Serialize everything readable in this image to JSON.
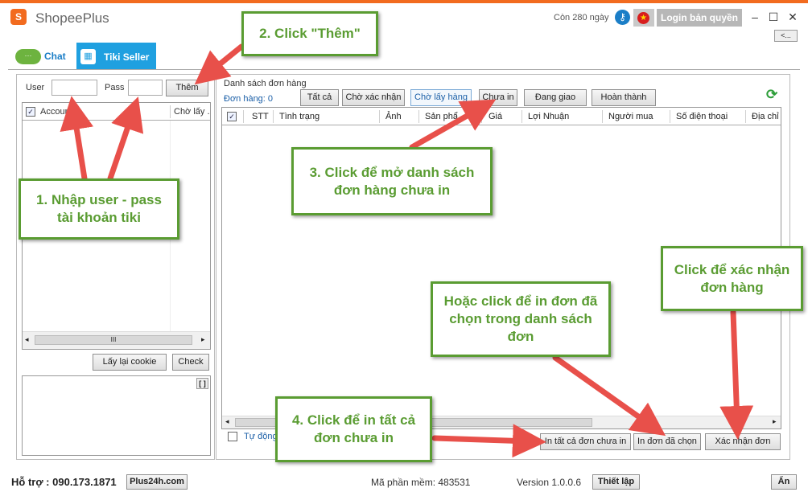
{
  "titlebar": {
    "logo_glyph": "S",
    "app_title": "ShopeePlus",
    "days_left": "Còn 280 ngày",
    "key_icon": "key-icon",
    "flag_icon": "vn-flag-icon",
    "flag_glyph": "★",
    "login_label": "Login bản quyền",
    "minimize": "–",
    "maximize": "☐",
    "close": "✕",
    "back_label": "<..."
  },
  "tabs": {
    "chat": {
      "label": "Chat",
      "icon": "chat-bubble-icon",
      "icon_glyph": "···"
    },
    "tiki": {
      "label": "Tiki Seller",
      "icon": "tiki-store-icon",
      "icon_glyph": "▦"
    }
  },
  "left_panel": {
    "user_label": "User",
    "user_value": "",
    "pass_label": "Pass",
    "pass_value": "",
    "add_button": "Thêm",
    "grid_headers": [
      "Accoun",
      "Chờ lấy ."
    ],
    "refresh_cookie_button": "Lấy lại cookie",
    "check_button": "Check",
    "log_badge": "[ ]",
    "scroll_thumb": "III",
    "scroll_left": "◂",
    "scroll_right": "▸"
  },
  "orders": {
    "title": "Danh sách đơn hàng",
    "count_label": "Đơn hàng: 0",
    "filters": [
      "Tất cả",
      "Chờ xác nhận",
      "Chờ lấy hàng",
      "Chưa in",
      "Đang giao",
      "Hoàn thành"
    ],
    "columns": [
      "STT",
      "Tình trạng",
      "Ảnh",
      "Sản phẩ",
      "Giá",
      "Lợi Nhuận",
      "Người mua",
      "Số điện thoại",
      "Địa chỉ"
    ],
    "refresh_icon": "refresh-icon",
    "refresh_glyph": "⟳",
    "auto_label": "Tự động",
    "print_all_button": "In tất cả đơn chưa in",
    "print_selected_button": "In đơn đã chọn",
    "confirm_button": "Xác nhận đơn",
    "scroll_left": "◂",
    "scroll_right": "▸"
  },
  "status_bar": {
    "support": "Hỗ trợ : 090.173.1871",
    "website": "Plus24h.com",
    "software_code": "Mã phần mềm: 483531",
    "version": "Version 1.0.0.6",
    "settings_button": "Thiết lập",
    "hide_button": "Ẩn"
  },
  "annotations": {
    "step1": "1. Nhập user - pass tài khoản tiki",
    "step2": "2. Click \"Thêm\"",
    "step3": "3. Click để mở danh sách đơn hàng chưa in",
    "step4": "4. Click để in tất cả đơn chưa in",
    "print_selected_hint": "Hoặc click để in đơn đã chọn trong danh sách đơn",
    "confirm_hint": "Click để xác nhận đơn hàng",
    "arrow_color": "#e8504a",
    "box_color": "#5a9c32"
  },
  "colors": {
    "accent": "#f26b1f",
    "tab_blue": "#1fa0e0",
    "link_blue": "#1b7ec7"
  }
}
